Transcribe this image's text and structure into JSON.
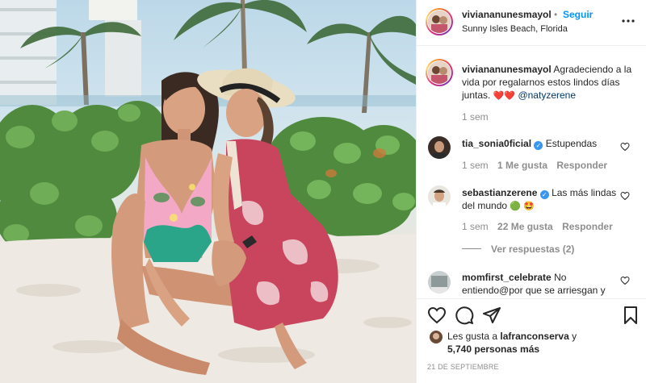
{
  "header": {
    "username": "viviananunesmayol",
    "dot": "•",
    "follow_label": "Seguir",
    "location": "Sunny Isles Beach, Florida",
    "more_icon": "more-horizontal-icon"
  },
  "caption": {
    "username": "viviananunesmayol",
    "text_line1": "Agradeciendo a la",
    "text_line2": "vida por regalarnos estos lindos días",
    "text_line3": "juntas.",
    "hearts": "❤️❤️",
    "mention": "@natyzerene",
    "time": "1 sem"
  },
  "comments": [
    {
      "username": "tia_sonia0ficial",
      "verified": true,
      "text": "Estupendas",
      "time": "1 sem",
      "likes": "1 Me gusta",
      "reply": "Responder"
    },
    {
      "username": "sebastianzerene",
      "verified": true,
      "text_line1": "Las más lindas",
      "text_line2": "del mundo",
      "emojis": "🟢 🤩",
      "time": "1 sem",
      "likes": "22 Me gusta",
      "reply": "Responder",
      "replies_label": "Ver respuestas (2)"
    },
    {
      "username": "momfirst_celebrate",
      "text_line1": "No",
      "text_line2": "entiendo@por que se arriesgan y"
    }
  ],
  "actions": {
    "likes_prefix": "Les gusta a",
    "liker": "lafranconserva",
    "likes_suffix": "y",
    "likes_count": "5,740 personas más",
    "date": "21 DE SEPTIEMBRE"
  },
  "colors": {
    "follow": "#0095f6",
    "verified": "#3897f0",
    "heart": "#ed4956"
  }
}
